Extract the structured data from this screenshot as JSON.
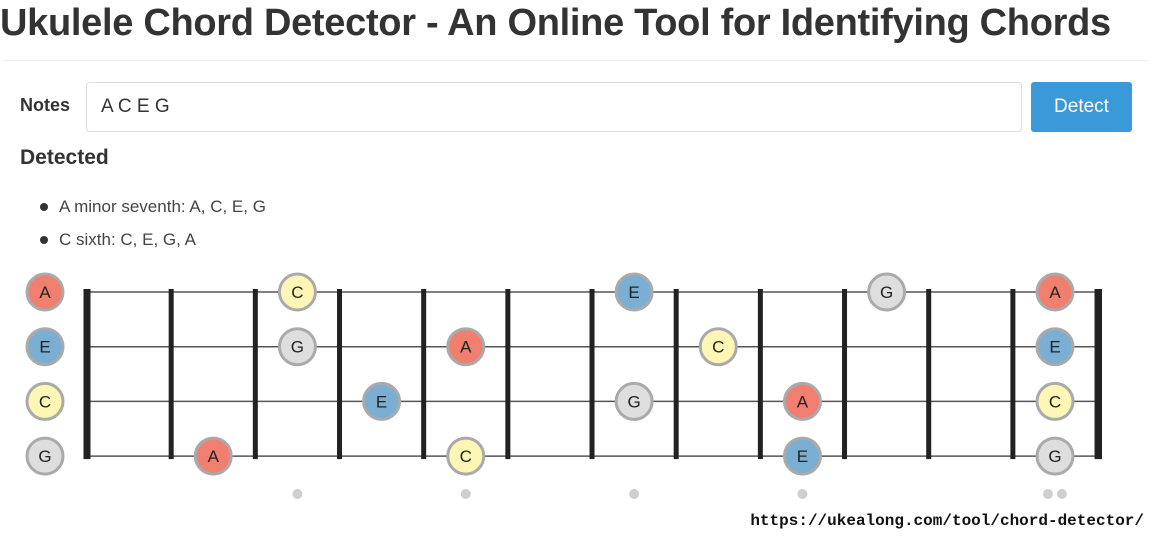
{
  "page": {
    "title": "Ukulele Chord Detector - An Online Tool for Identifying Chords"
  },
  "form": {
    "notes_label": "Notes",
    "notes_value": "A C E G",
    "detect_label": "Detect"
  },
  "results": {
    "heading": "Detected",
    "items": [
      "A minor seventh: A, C, E, G",
      "C sixth: C, E, G, A"
    ]
  },
  "fretboard": {
    "open_strings": [
      "A",
      "E",
      "C",
      "G"
    ],
    "fret_count": 12,
    "marker_frets": [
      3,
      5,
      7,
      9
    ],
    "double_marker_fret": 12,
    "positions": [
      {
        "string": 0,
        "fret": 0,
        "note": "A"
      },
      {
        "string": 0,
        "fret": 3,
        "note": "C"
      },
      {
        "string": 0,
        "fret": 7,
        "note": "E"
      },
      {
        "string": 0,
        "fret": 10,
        "note": "G"
      },
      {
        "string": 0,
        "fret": 12,
        "note": "A"
      },
      {
        "string": 1,
        "fret": 0,
        "note": "E"
      },
      {
        "string": 1,
        "fret": 3,
        "note": "G"
      },
      {
        "string": 1,
        "fret": 5,
        "note": "A"
      },
      {
        "string": 1,
        "fret": 8,
        "note": "C"
      },
      {
        "string": 1,
        "fret": 12,
        "note": "E"
      },
      {
        "string": 2,
        "fret": 0,
        "note": "C"
      },
      {
        "string": 2,
        "fret": 4,
        "note": "E"
      },
      {
        "string": 2,
        "fret": 7,
        "note": "G"
      },
      {
        "string": 2,
        "fret": 9,
        "note": "A"
      },
      {
        "string": 2,
        "fret": 12,
        "note": "C"
      },
      {
        "string": 3,
        "fret": 0,
        "note": "G"
      },
      {
        "string": 3,
        "fret": 2,
        "note": "A"
      },
      {
        "string": 3,
        "fret": 5,
        "note": "C"
      },
      {
        "string": 3,
        "fret": 9,
        "note": "E"
      },
      {
        "string": 3,
        "fret": 12,
        "note": "G"
      }
    ],
    "note_colors": {
      "A": "#f17f6f",
      "C": "#fdf6b4",
      "E": "#7aaed3",
      "G": "#dedede"
    }
  },
  "source": {
    "url": "https://ukealong.com/tool/chord-detector/"
  }
}
